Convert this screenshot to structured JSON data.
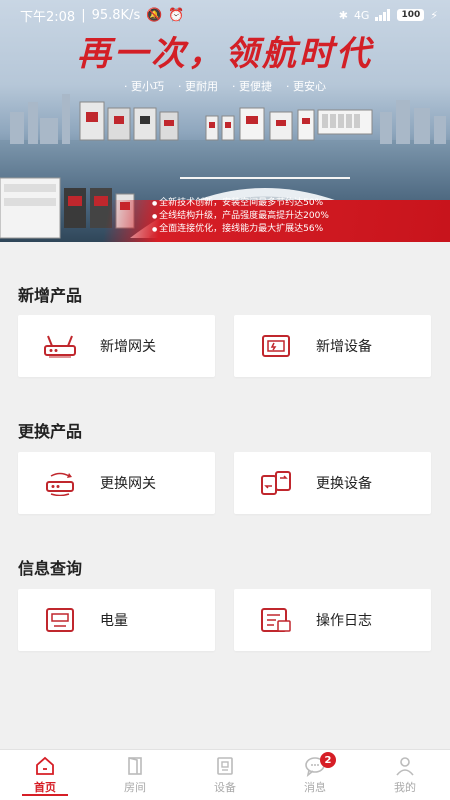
{
  "status_bar": {
    "time": "下午2:08",
    "speed": "95.8K/s",
    "network": "4G",
    "battery": "100"
  },
  "banner": {
    "headline": "再一次，领航时代",
    "taglines": [
      "更小巧",
      "更耐用",
      "更便捷",
      "更安心"
    ],
    "features": [
      "全新技术创新，安装空间最多节约达50%",
      "全线结构升级，产品强度最高提升达200%",
      "全面连接优化，接线能力最大扩展达56%"
    ]
  },
  "sections": [
    {
      "title": "新增产品",
      "cards": [
        {
          "label": "新增网关",
          "icon": "router-icon"
        },
        {
          "label": "新增设备",
          "icon": "device-box-icon"
        }
      ]
    },
    {
      "title": "更换产品",
      "cards": [
        {
          "label": "更换网关",
          "icon": "router-swap-icon"
        },
        {
          "label": "更换设备",
          "icon": "device-swap-icon"
        }
      ]
    },
    {
      "title": "信息查询",
      "cards": [
        {
          "label": "电量",
          "icon": "meter-icon"
        },
        {
          "label": "操作日志",
          "icon": "log-icon"
        }
      ]
    }
  ],
  "tabbar": [
    {
      "label": "首页",
      "icon": "home-icon",
      "active": true
    },
    {
      "label": "房间",
      "icon": "door-icon"
    },
    {
      "label": "设备",
      "icon": "device-icon"
    },
    {
      "label": "消息",
      "icon": "message-icon",
      "badge": "2"
    },
    {
      "label": "我的",
      "icon": "person-icon"
    }
  ],
  "colors": {
    "accent": "#d61e26",
    "background": "#f0f0f0",
    "icon_red": "#c0272d"
  }
}
